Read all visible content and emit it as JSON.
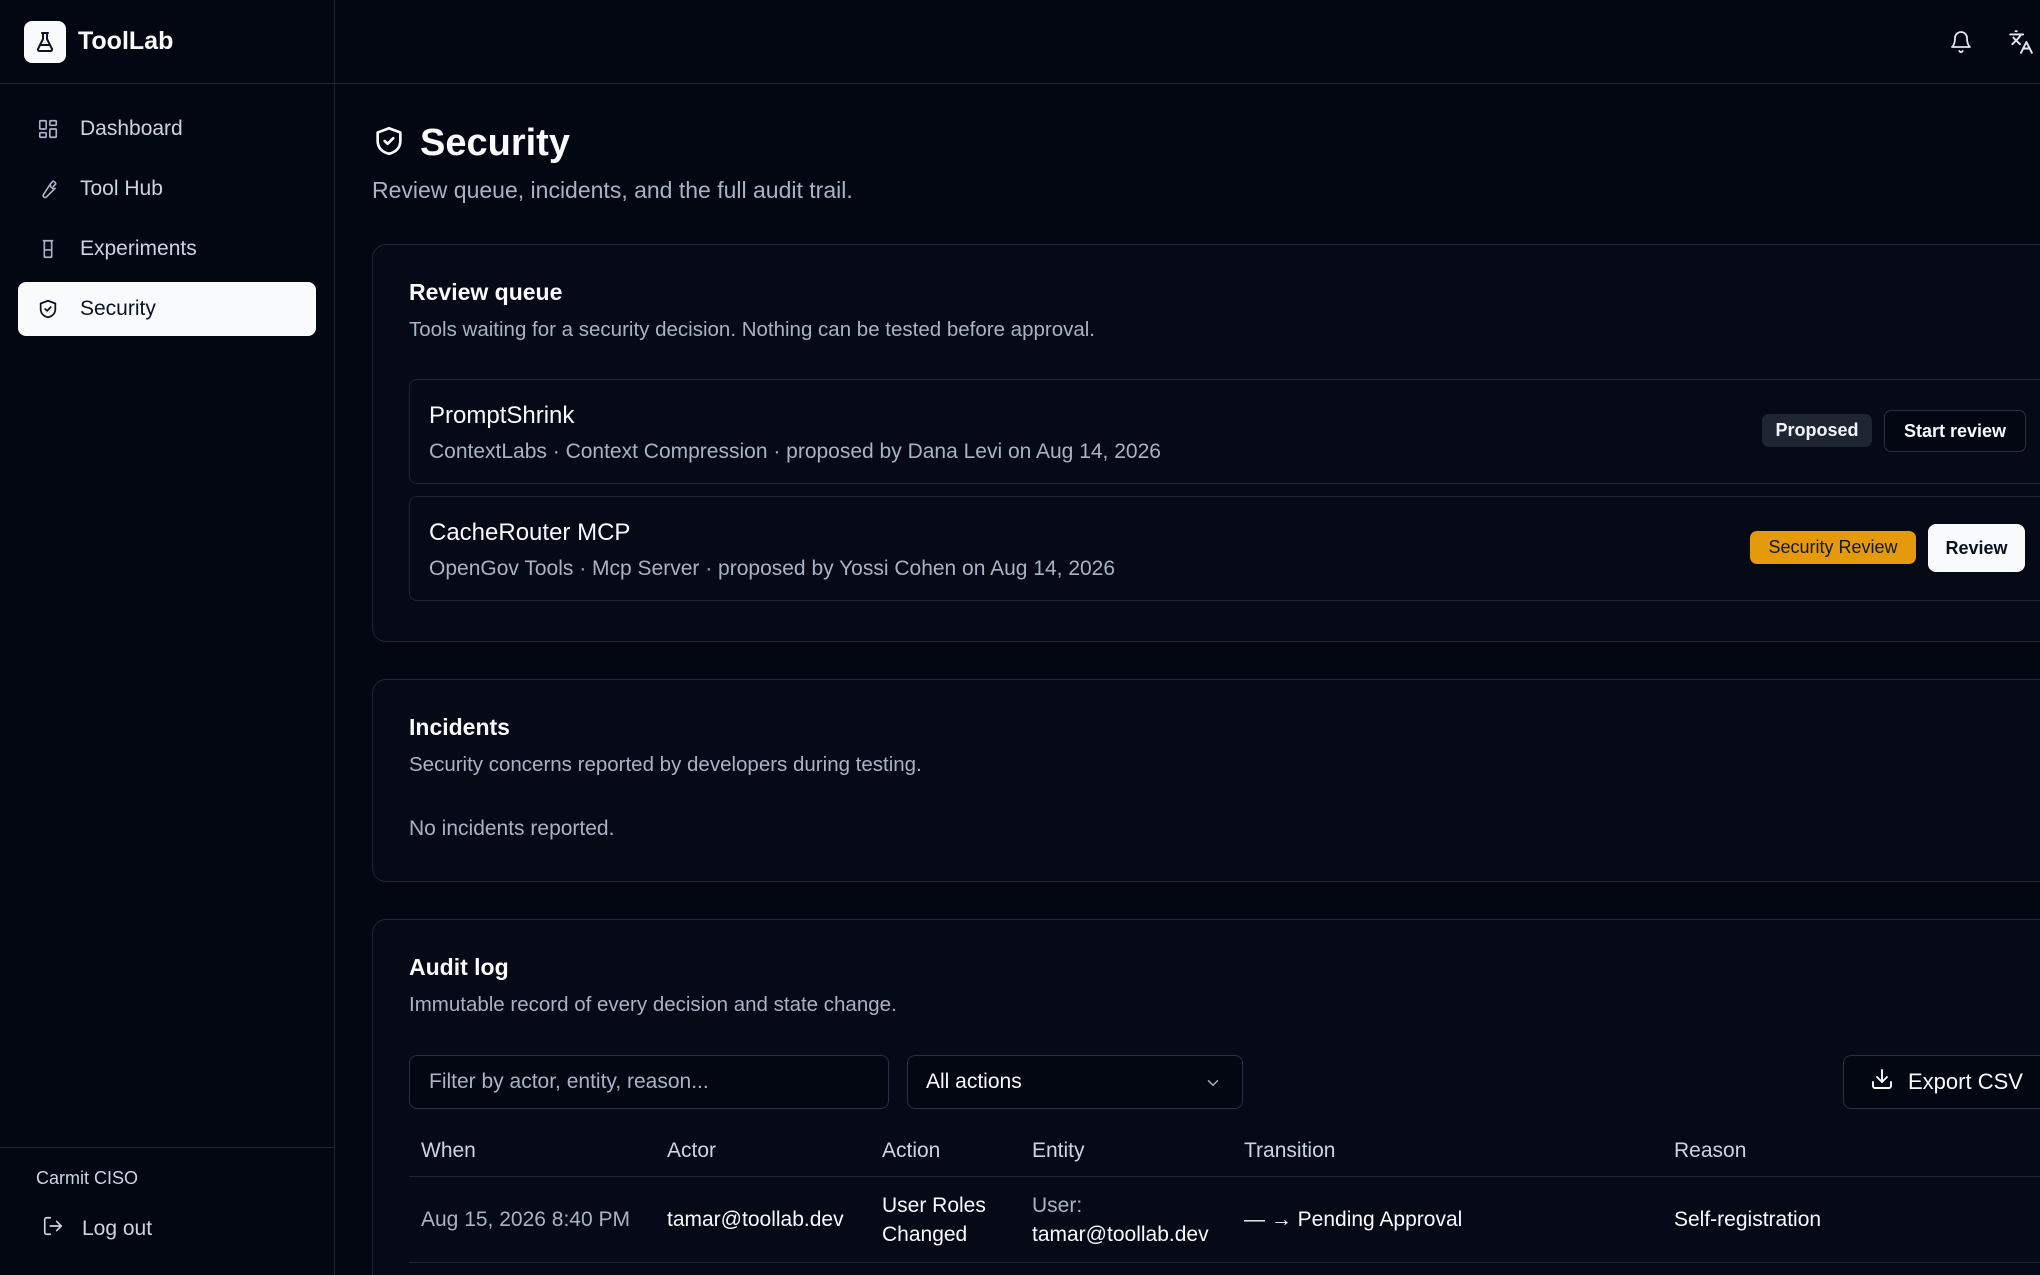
{
  "app": {
    "name": "ToolLab"
  },
  "sidebar": {
    "items": [
      {
        "label": "Dashboard",
        "icon": "dashboard-icon"
      },
      {
        "label": "Tool Hub",
        "icon": "wrench-icon"
      },
      {
        "label": "Experiments",
        "icon": "flask-icon"
      },
      {
        "label": "Security",
        "icon": "shield-icon",
        "active": true
      }
    ],
    "user": "Carmit CISO",
    "logout_label": "Log out"
  },
  "topbar": {
    "icons": [
      "bell-icon",
      "translate-icon"
    ]
  },
  "page": {
    "title": "Security",
    "subtitle": "Review queue, incidents, and the full audit trail."
  },
  "review_queue": {
    "title": "Review queue",
    "description": "Tools waiting for a security decision. Nothing can be tested before approval.",
    "items": [
      {
        "name": "PromptShrink",
        "meta": "ContextLabs · Context Compression · proposed by Dana Levi on Aug 14, 2026",
        "status": "Proposed",
        "status_color": "#1e2533",
        "action": "Start review"
      },
      {
        "name": "CacheRouter MCP",
        "meta": "OpenGov Tools · Mcp Server · proposed by Yossi Cohen on Aug 14, 2026",
        "status": "Security Review",
        "status_color": "#e59a0b",
        "action": "Review"
      }
    ]
  },
  "incidents": {
    "title": "Incidents",
    "description": "Security concerns reported by developers during testing.",
    "empty": "No incidents reported."
  },
  "audit_log": {
    "title": "Audit log",
    "description": "Immutable record of every decision and state change.",
    "filter_placeholder": "Filter by actor, entity, reason...",
    "action_select": "All actions",
    "export_label": "Export CSV",
    "columns": [
      "When",
      "Actor",
      "Action",
      "Entity",
      "Transition",
      "Reason"
    ],
    "rows": [
      {
        "when": "Aug 15, 2026 8:40 PM",
        "actor": "tamar@toollab.dev",
        "action_line1": "User Roles",
        "action_line2": "Changed",
        "entity_line1": "User:",
        "entity_line2": "tamar@toollab.dev",
        "transition": "— → Pending Approval",
        "reason": "Self-registration"
      }
    ]
  }
}
